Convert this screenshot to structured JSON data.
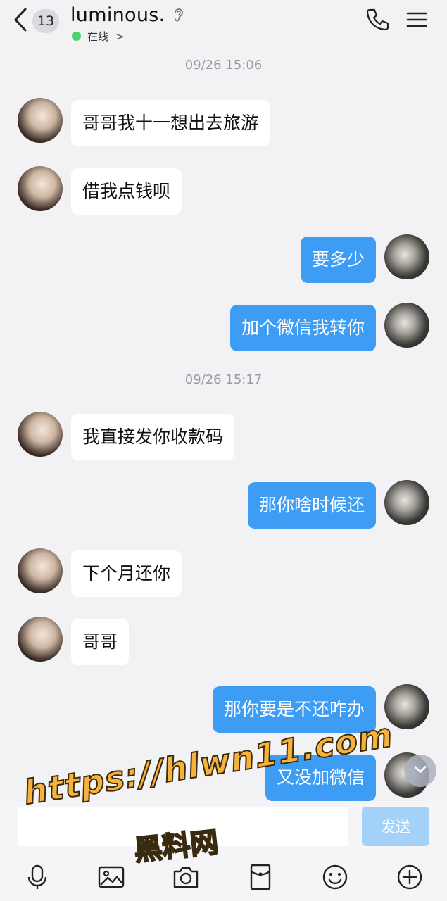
{
  "header": {
    "unread_count": "13",
    "title": "luminous.",
    "status": "在线",
    "status_chevron": ">"
  },
  "chat": {
    "timestamps": [
      "09/26 15:06",
      "09/26 15:17"
    ],
    "messages": [
      {
        "side": "in",
        "text": "哥哥我十一想出去旅游"
      },
      {
        "side": "in",
        "text": "借我点钱呗"
      },
      {
        "side": "out",
        "text": "要多少"
      },
      {
        "side": "out",
        "text": "加个微信我转你"
      },
      {
        "side": "in",
        "text": "我直接发你收款码"
      },
      {
        "side": "out",
        "text": "那你啥时候还"
      },
      {
        "side": "in",
        "text": "下个月还你"
      },
      {
        "side": "in",
        "text": "哥哥"
      },
      {
        "side": "out",
        "text": "那你要是不还咋办"
      },
      {
        "side": "out",
        "text": "又没加微信"
      }
    ]
  },
  "composer": {
    "input_value": "",
    "send_label": "发送"
  },
  "watermark": {
    "url": "https://hlwn11.com",
    "text": "黑料网"
  },
  "colors": {
    "outgoing_bubble": "#3d9cf4",
    "incoming_bubble": "#ffffff",
    "online_dot": "#4cd46a",
    "send_button": "#a3d1f8"
  },
  "icons": [
    "back-icon",
    "ear-icon",
    "phone-icon",
    "menu-icon",
    "chevron-down-icon",
    "mic-icon",
    "image-icon",
    "camera-icon",
    "red-packet-icon",
    "emoji-icon",
    "plus-icon"
  ]
}
